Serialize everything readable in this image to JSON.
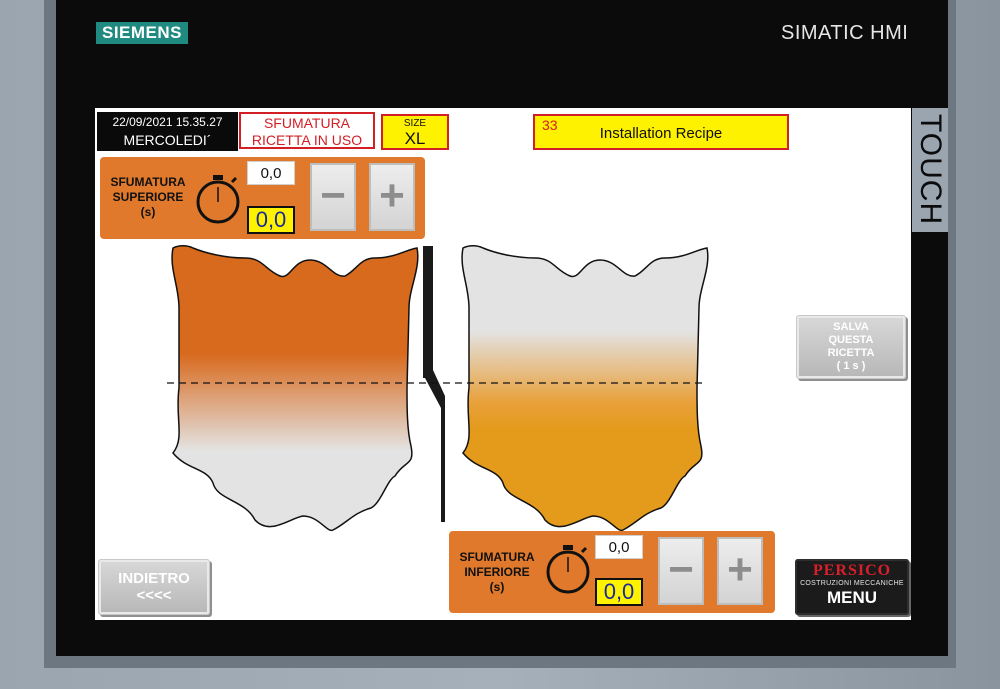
{
  "device": {
    "brand": "SIEMENS",
    "model": "SIMATIC HMI",
    "touch_label": "TOUCH"
  },
  "header": {
    "date_time": "22/09/2021 15.35.27",
    "weekday": "MERCOLEDI´",
    "recipe_status_line1": "SFUMATURA",
    "recipe_status_line2": "RICETTA IN USO",
    "size_label": "SIZE",
    "size_value": "XL",
    "recipe_number": "33",
    "recipe_name": "Installation Recipe"
  },
  "upper_shading": {
    "label_line1": "SFUMATURA",
    "label_line2": "SUPERIORE",
    "label_line3": "(s)",
    "setpoint": "0,0",
    "actual": "0,0",
    "minus_label": "−",
    "plus_label": "+",
    "icon": "stopwatch-icon"
  },
  "lower_shading": {
    "label_line1": "SFUMATURA",
    "label_line2": "INFERIORE",
    "label_line3": "(s)",
    "setpoint": "0,0",
    "actual": "0,0",
    "minus_label": "−",
    "plus_label": "+",
    "icon": "stopwatch-icon"
  },
  "buttons": {
    "save_line1": "SALVA",
    "save_line2": "QUESTA",
    "save_line3": "RICETTA",
    "save_line4": "( 1 s )",
    "back_line1": "INDIETRO",
    "back_line2": "<<<<",
    "menu_logo": "PERSICO",
    "menu_logo_sub": "COSTRUZIONI MECCANICHE",
    "menu_label": "MENU"
  },
  "colors": {
    "panel_orange": "#e0792b",
    "hide_left": "#d86a1e",
    "hide_right": "#e49a1a",
    "value_yellow": "#fff200",
    "alert_red": "#d21f25",
    "siemens_teal": "#1f8a7f"
  }
}
